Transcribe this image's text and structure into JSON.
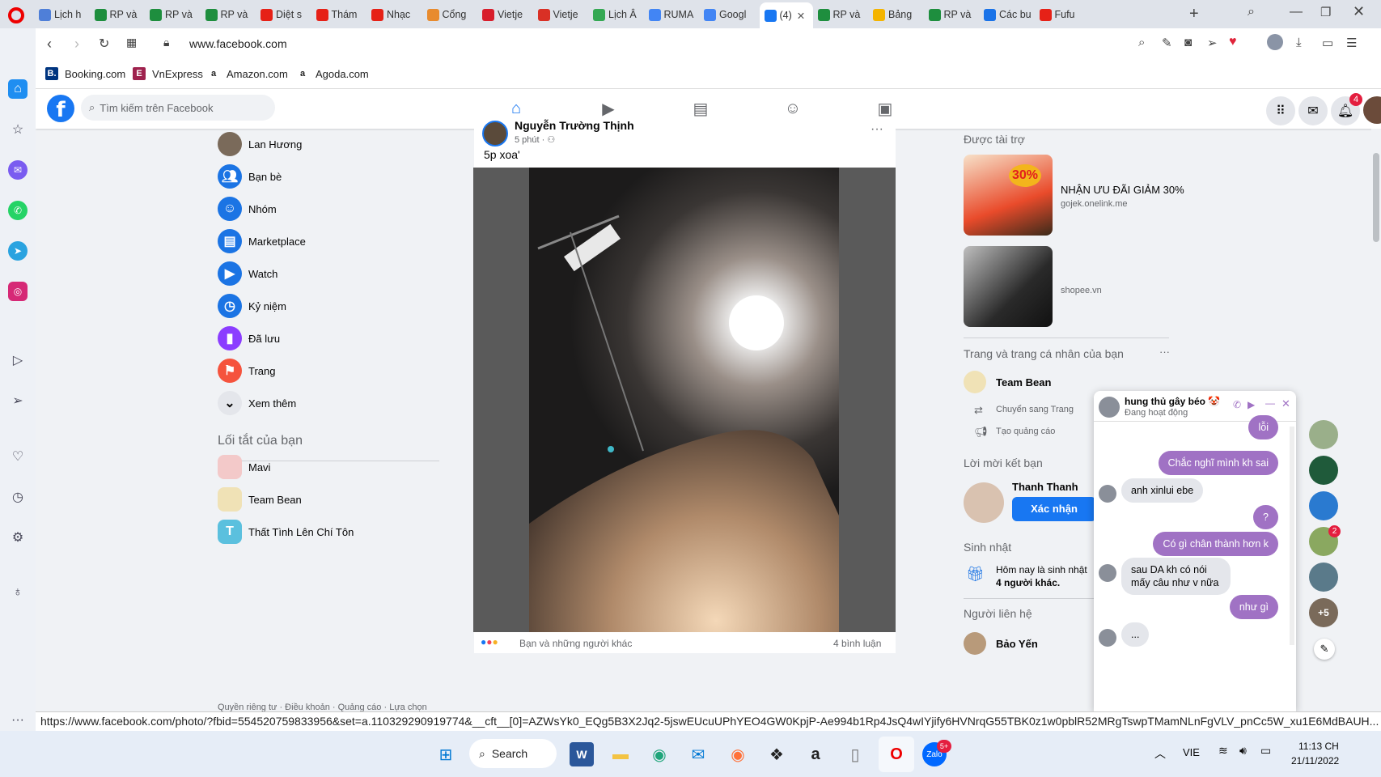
{
  "browser": {
    "tabs": [
      {
        "label": "Lịch h",
        "icon": "globe-icon",
        "color": "#4f7fd8"
      },
      {
        "label": "RP và",
        "icon": "sheets-icon",
        "color": "#1e8e3e"
      },
      {
        "label": "RP và",
        "icon": "sheets-icon",
        "color": "#1e8e3e"
      },
      {
        "label": "RP và",
        "icon": "sheets-icon",
        "color": "#1e8e3e"
      },
      {
        "label": "Diệt s",
        "icon": "youtube-icon",
        "color": "#e62117"
      },
      {
        "label": "Thám",
        "icon": "youtube-icon",
        "color": "#e62117"
      },
      {
        "label": "Nhạc",
        "icon": "youtube-icon",
        "color": "#e62117"
      },
      {
        "label": "Cổng",
        "icon": "portal-icon",
        "color": "#e88b2e"
      },
      {
        "label": "Vietje",
        "icon": "plane-icon",
        "color": "#d81e2c"
      },
      {
        "label": "Vietje",
        "icon": "gmail-icon",
        "color": "#d93025"
      },
      {
        "label": "Lịch Â",
        "icon": "calendar-icon",
        "color": "#34a853"
      },
      {
        "label": "RUMA",
        "icon": "google-icon",
        "color": "#4285f4"
      },
      {
        "label": "Googl",
        "icon": "translate-icon",
        "color": "#4285f4"
      },
      {
        "label": "(4)",
        "icon": "facebook-icon",
        "color": "#1877f2",
        "active": true
      },
      {
        "label": "RP và",
        "icon": "sheets-icon",
        "color": "#1e8e3e"
      },
      {
        "label": "Bảng",
        "icon": "slides-icon",
        "color": "#f4b400"
      },
      {
        "label": "RP và",
        "icon": "sheets-icon",
        "color": "#1e8e3e"
      },
      {
        "label": "Các bu",
        "icon": "ads-icon",
        "color": "#1a73e8"
      },
      {
        "label": "Fufu",
        "icon": "youtube-icon",
        "color": "#e62117"
      }
    ],
    "url": "www.facebook.com",
    "bookmarks": [
      {
        "label": "Booking.com",
        "icon": "booking-icon",
        "color": "#003580",
        "glyph": "B."
      },
      {
        "label": "VnExpress",
        "icon": "vnexpress-icon",
        "color": "#9f224e",
        "glyph": "E"
      },
      {
        "label": "Amazon.com",
        "icon": "amazon-icon",
        "color": "#222",
        "glyph": "a"
      },
      {
        "label": "Agoda.com",
        "icon": "agoda-icon",
        "color": "#777",
        "glyph": "a"
      }
    ],
    "status_url": "https://www.facebook.com/photo/?fbid=554520759833956&set=a.110329290919774&__cft__[0]=AZWsYk0_EQg5B3X2Jq2-5jswEUcuUPhYEO4GW0KpjP-Ae994b1Rp4JsQ4wIYjify6HVNrqG55TBK0z1w0pblR52MRgTswpTMamNLnFgVLV_pnCc5W_xu1E6MdBAUH..."
  },
  "fb": {
    "search_placeholder": "Tìm kiếm trên Facebook",
    "notif_count": "4",
    "left_nav": [
      {
        "label": "Lan Hương",
        "icon": "avatar",
        "color": "#7a6a5a"
      },
      {
        "label": "Bạn bè",
        "icon": "friends-icon",
        "color": "#1b74e4"
      },
      {
        "label": "Nhóm",
        "icon": "groups-icon",
        "color": "#1b74e4"
      },
      {
        "label": "Marketplace",
        "icon": "marketplace-icon",
        "color": "#1b74e4"
      },
      {
        "label": "Watch",
        "icon": "watch-icon",
        "color": "#1b74e4"
      },
      {
        "label": "Kỷ niệm",
        "icon": "memories-icon",
        "color": "#1b74e4"
      },
      {
        "label": "Đã lưu",
        "icon": "saved-icon",
        "color": "#8b3dff"
      },
      {
        "label": "Trang",
        "icon": "pages-icon",
        "color": "#f5533d"
      },
      {
        "label": "Xem thêm",
        "icon": "chevron-down-icon",
        "color": "#e4e6eb"
      }
    ],
    "shortcuts_title": "Lối tắt của bạn",
    "shortcuts": [
      {
        "label": "Mavi",
        "color": "#f3c9c9",
        "glyph": ""
      },
      {
        "label": "Team Bean",
        "color": "#f0e2b6",
        "glyph": ""
      },
      {
        "label": "Thất Tình Lên Chí Tôn",
        "color": "#5bc0de",
        "glyph": "T"
      }
    ],
    "footer": "Quyền riêng tư · Điều khoản · Quảng cáo · Lựa chọn",
    "post": {
      "author": "Nguyễn Trường Thịnh",
      "time": "5 phút ·",
      "text": "5p xoa'",
      "reactions": "Bạn và những người khác",
      "comments": "4 bình luận"
    },
    "right": {
      "sponsored_title": "Được tài trợ",
      "ads": [
        {
          "title": "NHẬN ƯU ĐÃI GIẢM 30%",
          "domain": "gojek.onelink.me"
        },
        {
          "title": "",
          "domain": "shopee.vn"
        }
      ],
      "pages_title": "Trang và trang cá nhân của bạn",
      "page_name": "Team Bean",
      "switch_label": "Chuyển sang Trang",
      "ad_label": "Tạo quảng cáo",
      "friend_req_title": "Lời mời kết bạn",
      "friend_name": "Thanh Thanh",
      "confirm_label": "Xác nhận",
      "birthday_title": "Sinh nhật",
      "birthday_text": "Hôm nay là sinh nhật",
      "birthday_count": "4 người khác.",
      "contacts_title": "Người liên hệ",
      "contact_name": "Bảo Yến"
    },
    "chat": {
      "name": "hung thủ gây béo 🤡",
      "status": "Đang hoạt động",
      "messages": [
        {
          "from": "me",
          "text": "lỗi"
        },
        {
          "from": "me",
          "text": "Chắc nghĩ mình kh sai"
        },
        {
          "from": "them",
          "text": "anh xinlui ebe"
        },
        {
          "from": "me",
          "text": "?"
        },
        {
          "from": "me",
          "text": "Có gì chân thành hơn k"
        },
        {
          "from": "them",
          "text": "sau DA kh có nói mấy câu như v nữa"
        },
        {
          "from": "me",
          "text": "như gì"
        },
        {
          "from": "them",
          "text": "..."
        }
      ],
      "more_count": "+5",
      "bubble_badge": "2"
    }
  },
  "taskbar": {
    "search_label": "Search",
    "lang": "VIE",
    "time": "11:13 CH",
    "date": "21/11/2022",
    "zalo_badge": "5+"
  }
}
